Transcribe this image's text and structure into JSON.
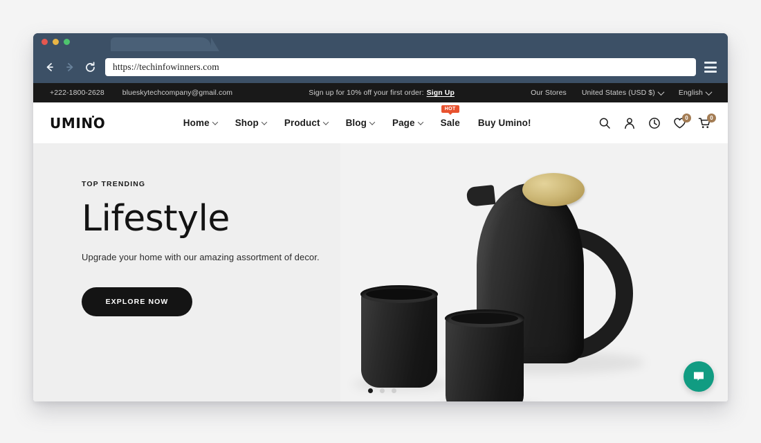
{
  "browser": {
    "address": "https://techinfowinners.com",
    "back_icon": "back-arrow-icon",
    "forward_icon": "forward-arrow-icon",
    "reload_icon": "reload-icon",
    "menu_icon": "hamburger-menu-icon"
  },
  "announcement": {
    "phone": "+222-1800-2628",
    "email": "blueskytechcompany@gmail.com",
    "promo_text": "Sign up for 10% off your first order:",
    "promo_link": "Sign Up",
    "stores": "Our Stores",
    "country": "United States (USD $)",
    "language": "English"
  },
  "nav": {
    "logo": "UMINO",
    "logo_part1": "UMI",
    "logo_part2": "N",
    "logo_part3": "O",
    "items": [
      {
        "label": "Home",
        "has_caret": true
      },
      {
        "label": "Shop",
        "has_caret": true
      },
      {
        "label": "Product",
        "has_caret": true
      },
      {
        "label": "Blog",
        "has_caret": true
      },
      {
        "label": "Page",
        "has_caret": true
      },
      {
        "label": "Sale",
        "has_caret": false,
        "badge": "HOT"
      },
      {
        "label": "Buy Umino!",
        "has_caret": false
      }
    ],
    "icons": {
      "search": "search-icon",
      "account": "user-account-icon",
      "history": "clock-history-icon",
      "wishlist": "heart-wishlist-icon",
      "cart": "shopping-cart-icon"
    },
    "wishlist_count": "0",
    "cart_count": "0",
    "badge_color": "#a37c54"
  },
  "hero": {
    "eyebrow": "TOP TRENDING",
    "title": "Lifestyle",
    "subtitle": "Upgrade your home with our amazing assortment of decor.",
    "cta": "EXPLORE NOW",
    "background_color": "#efefef",
    "cta_color": "#141414",
    "slides_total": 3,
    "active_slide": 1
  },
  "chat": {
    "icon": "chat-bubble-icon",
    "color": "#119c82"
  }
}
